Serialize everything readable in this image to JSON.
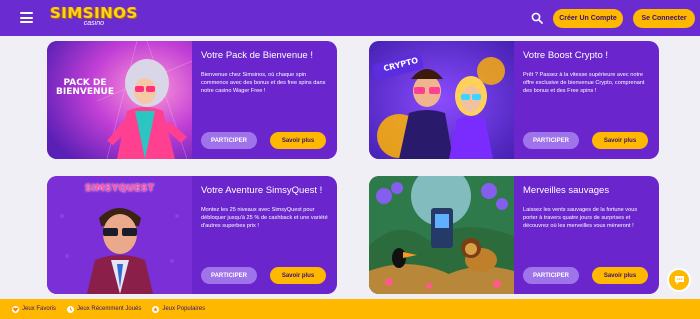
{
  "header": {
    "logo_main": "SIMSINOS",
    "logo_sub": "casino",
    "signup_label": "Créer Un Compte",
    "login_label": "Se Connecter"
  },
  "cards": [
    {
      "title": "Votre Pack de Bienvenue !",
      "text": "Bienvenue chez Simsinos, où chaque spin commence avec des bonus et des free spins dans notre casino Wager Free !",
      "image_label": "PACK DE BIENVENUE",
      "participate": "PARTICIPER",
      "more": "Savoir plus"
    },
    {
      "title": "Votre Boost Crypto !",
      "text": "Prêt ? Passez à la vitesse supérieure avec notre offre exclusive de bienvenue Crypto, comprenant des bonus et des Free spins !",
      "image_label": "CRYPTO",
      "participate": "PARTICIPER",
      "more": "Savoir plus"
    },
    {
      "title": "Votre Aventure SimsyQuest !",
      "text": "Montez les 25 niveaux avec SimsyQuest pour débloquer jusqu'à 25 % de cashback et une variété d'autres superbes prix !",
      "image_label": "SIMSYQUEST",
      "participate": "PARTICIPER",
      "more": "Savoir plus"
    },
    {
      "title": "Merveilles sauvages",
      "text": "Laissez les vents sauvages de la fortune vous porter à travers quatre jours de surprises et découvrez où les merveilles vous mèneront !",
      "participate": "PARTICIPER",
      "more": "Savoir plus"
    }
  ],
  "footer": {
    "items": [
      "Jeux Favoris",
      "Jeux Récemment Joués",
      "Jeux Populaires"
    ]
  },
  "colors": {
    "brand_purple": "#6a2bd0",
    "accent_yellow": "#ffb800",
    "card_purple": "#6a26cc"
  },
  "icons": [
    "menu-icon",
    "search-icon",
    "heart-icon",
    "clock-icon",
    "star-icon",
    "chat-icon"
  ]
}
